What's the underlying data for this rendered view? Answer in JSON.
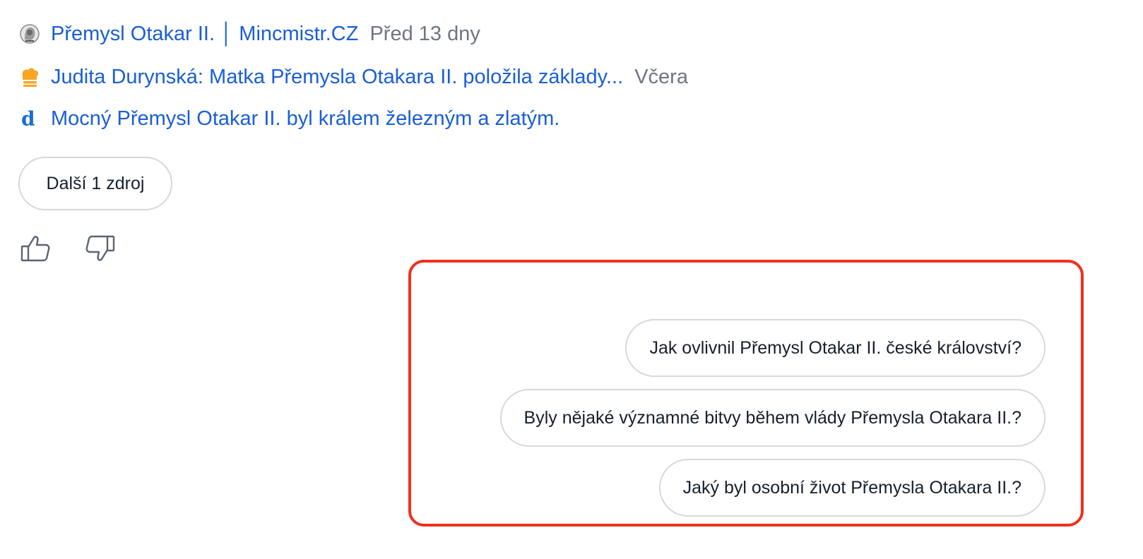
{
  "sources": [
    {
      "icon": "coin-portrait-icon",
      "title": "Přemysl Otakar II. │ Mincmistr.CZ",
      "time": "Před 13 dny"
    },
    {
      "icon": "chef-hat-icon",
      "title": "Judita Durynská: Matka Přemysla Otakara II. položila základy...",
      "time": "Včera"
    },
    {
      "icon": "letter-d-icon",
      "title": "Mocný Přemysl Otakar II. byl králem železným a zlatým.",
      "time": ""
    }
  ],
  "more_sources_label": "Další 1 zdroj",
  "feedback": {
    "like_icon": "thumbs-up-icon",
    "dislike_icon": "thumbs-down-icon"
  },
  "suggestions": [
    "Jak ovlivnil Přemysl Otakar II. české království?",
    "Byly nějaké významné bitvy během vlády Přemysla Otakara II.?",
    "Jaký byl osobní život Přemysla Otakara II.?"
  ],
  "colors": {
    "link": "#1a5ed6",
    "muted": "#6e7683",
    "highlight_border": "#f0301f",
    "chip_border": "#d6d8dc",
    "text": "#16202c"
  }
}
